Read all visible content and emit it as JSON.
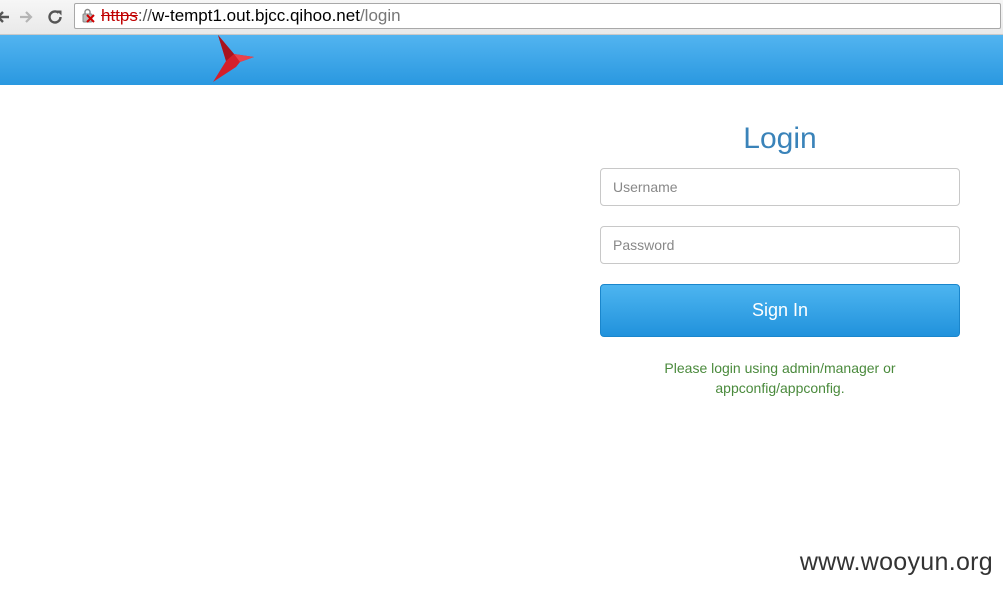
{
  "browser": {
    "url_scheme": "https",
    "url_separator": "://",
    "url_host": "w-tempt1.out.bjcc.qihoo.net",
    "url_path": "/login",
    "icons": {
      "back": "back-arrow-icon",
      "forward": "forward-arrow-icon",
      "reload": "reload-icon",
      "security": "broken-lock-icon"
    }
  },
  "header": {
    "logo": "red-bird-logo",
    "color": "#2a98e0"
  },
  "login": {
    "title": "Login",
    "username_placeholder": "Username",
    "password_placeholder": "Password",
    "submit_label": "Sign In",
    "hint": "Please login using admin/manager or appconfig/appconfig."
  },
  "watermark": "www.wooyun.org"
}
